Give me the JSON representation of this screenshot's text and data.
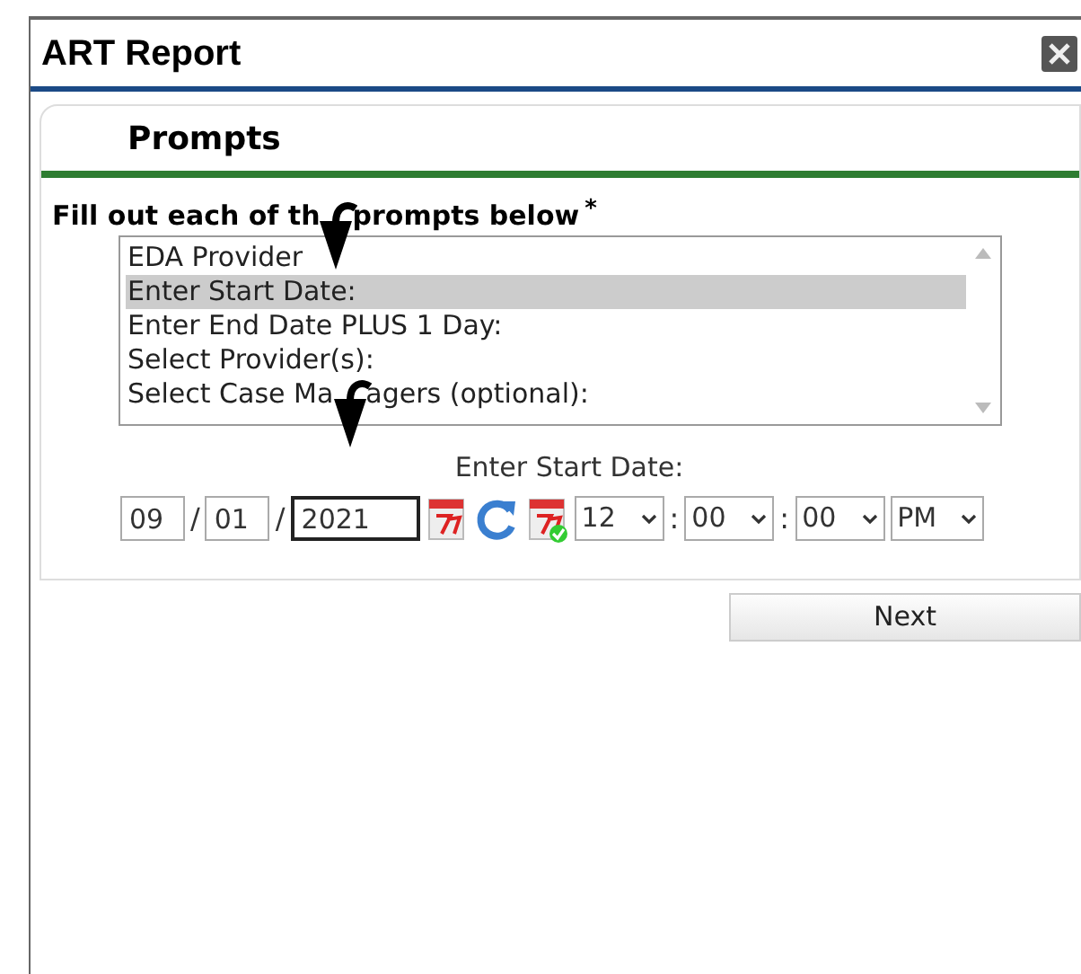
{
  "window": {
    "title": "ART Report"
  },
  "section": {
    "title": "Prompts"
  },
  "instruction_parts": [
    "Fill out each of th",
    "prompts below"
  ],
  "required_mark": "*",
  "prompts": [
    {
      "label_parts": [
        "EDA Provider"
      ],
      "selected": false
    },
    {
      "label_parts": [
        "Enter Start Date:"
      ],
      "selected": true
    },
    {
      "label_parts": [
        "Enter End Date PLUS 1 Day:"
      ],
      "selected": false
    },
    {
      "label_parts": [
        "Select Provider(s):"
      ],
      "selected": false
    },
    {
      "label_parts": [
        "Select Case Ma",
        "agers (optional):"
      ],
      "selected": false
    }
  ],
  "date_prompt": {
    "label": "Enter Start Date:",
    "month": "09",
    "day": "01",
    "year": "2021",
    "separator": "/",
    "hour": "12",
    "minute": "00",
    "second": "00",
    "ampm": "PM",
    "time_separator": ":"
  },
  "buttons": [
    "Next"
  ]
}
